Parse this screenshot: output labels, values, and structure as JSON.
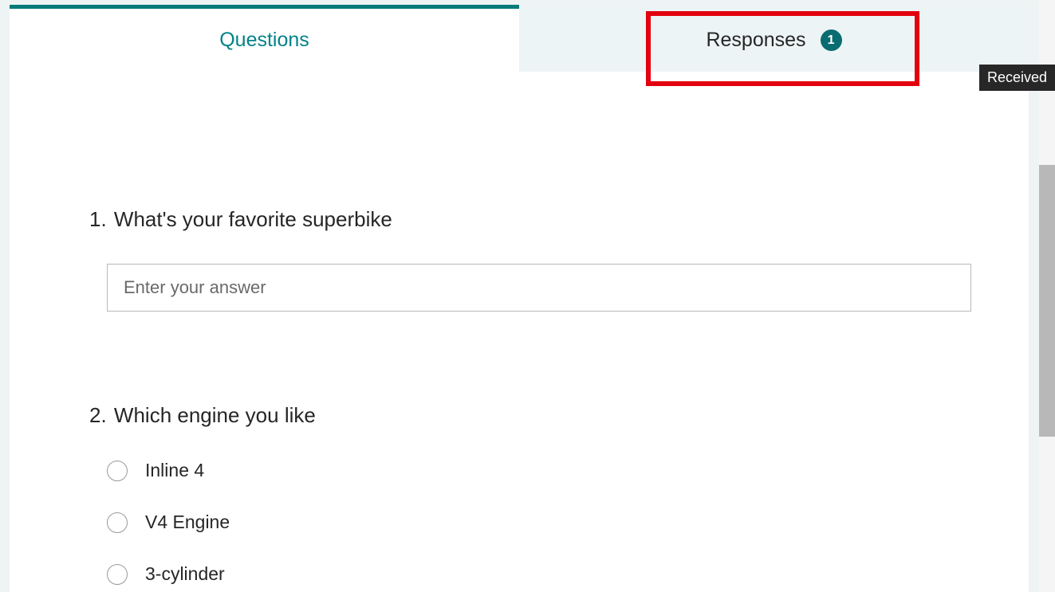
{
  "tabs": {
    "questions_label": "Questions",
    "responses_label": "Responses",
    "responses_count": "1"
  },
  "tooltip": {
    "received": "Received"
  },
  "questions": [
    {
      "number": "1.",
      "text": "What's your favorite superbike",
      "type": "text",
      "placeholder": "Enter your answer"
    },
    {
      "number": "2.",
      "text": "Which engine you like",
      "type": "choice",
      "options": [
        "Inline 4",
        "V4 Engine",
        "3-cylinder"
      ]
    }
  ]
}
